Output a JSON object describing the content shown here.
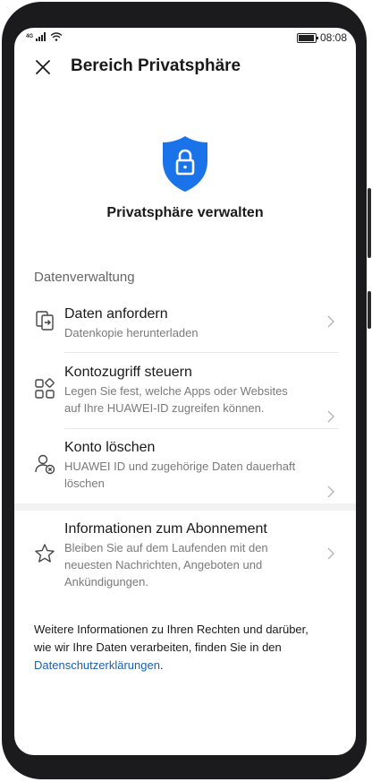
{
  "status_bar": {
    "network": "4G",
    "time": "08:08"
  },
  "header": {
    "title": "Bereich Privatsphäre",
    "close_icon": "close-icon"
  },
  "hero": {
    "icon": "shield-lock-icon",
    "title": "Privatsphäre verwalten",
    "accent_color": "#1a73e8"
  },
  "section": {
    "title": "Datenverwaltung"
  },
  "items": [
    {
      "icon": "data-request-icon",
      "title": "Daten anfordern",
      "subtitle_line1": "Datenkopie herunterladen",
      "subtitle_line2": ""
    },
    {
      "icon": "apps-grid-icon",
      "title": "Kontozugriff steuern",
      "subtitle_line1": "Legen Sie fest, welche Apps oder Websites",
      "subtitle_line2": "auf Ihre HUAWEI-ID zugreifen können."
    },
    {
      "icon": "delete-account-icon",
      "title": "Konto löschen",
      "subtitle_line1": "HUAWEI ID und zugehörige Daten dauerhaft",
      "subtitle_line2": "löschen"
    },
    {
      "icon": "star-icon",
      "title": "Informationen zum Abonnement",
      "subtitle_line1": "Bleiben Sie auf dem Laufenden mit den",
      "subtitle_line2": "neuesten Nachrichten, Angeboten und",
      "subtitle_line3": "Ankündigungen."
    }
  ],
  "footer": {
    "text_line1": "Weitere Informationen zu Ihren Rechten und darüber,",
    "text_line2": "wie wir Ihre Daten verarbeiten, finden Sie in den",
    "link": "Datenschutzerklärungen",
    "suffix": ".",
    "link_color": "#1a5fb4"
  }
}
